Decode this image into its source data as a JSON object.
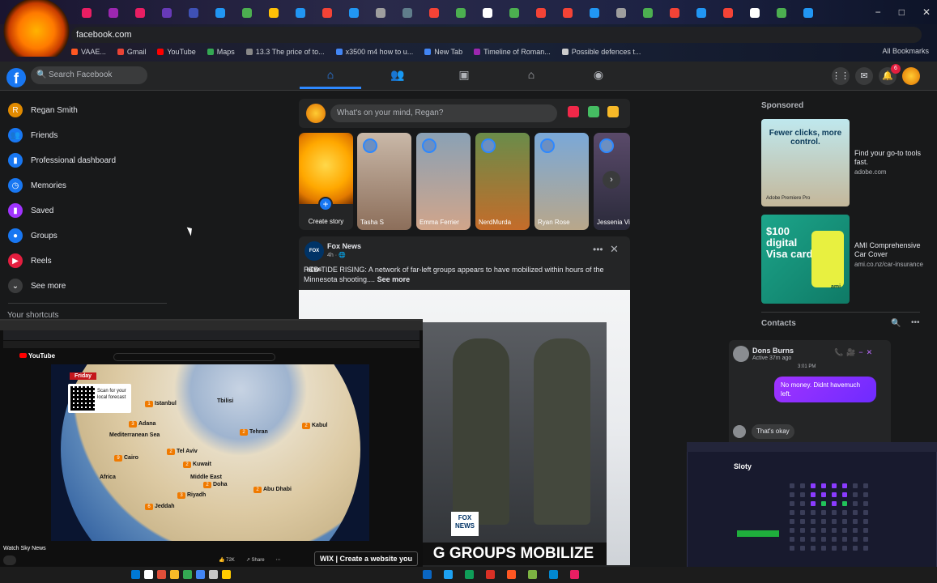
{
  "browser": {
    "url": "facebook.com",
    "bookmarks": [
      {
        "label": "VAAE...",
        "color": "#ff5722"
      },
      {
        "label": "Gmail",
        "color": "#ea4335"
      },
      {
        "label": "YouTube",
        "color": "#ff0000"
      },
      {
        "label": "Maps",
        "color": "#34a853"
      },
      {
        "label": "13.3 The price of to...",
        "color": "#888888"
      },
      {
        "label": "x3500 m4 how to u...",
        "color": "#4285f4"
      },
      {
        "label": "New Tab",
        "color": "#4285f4"
      },
      {
        "label": "Timeline of Roman...",
        "color": "#9c27b0"
      },
      {
        "label": "Possible defences t...",
        "color": "#cccccc"
      }
    ],
    "all_bookmarks": "All Bookmarks",
    "window_controls": [
      "−",
      "□",
      "✕"
    ]
  },
  "fb": {
    "logo_icon": "facebook-icon",
    "search_placeholder": "Search Facebook",
    "nav_tabs": [
      "home-icon",
      "friends-icon",
      "watch-icon",
      "marketplace-icon",
      "groups-icon"
    ],
    "right_icons": [
      "menu-grid-icon",
      "messenger-icon",
      "notifications-icon",
      "account-icon"
    ],
    "notification_count": "6"
  },
  "sidebar": {
    "items": [
      {
        "label": "Regan Smith",
        "color": "#e08a00",
        "icon": "R"
      },
      {
        "label": "Friends",
        "color": "#1877f2",
        "icon": "👥"
      },
      {
        "label": "Professional dashboard",
        "color": "#1877f2",
        "icon": "▮"
      },
      {
        "label": "Memories",
        "color": "#1877f2",
        "icon": "◷"
      },
      {
        "label": "Saved",
        "color": "#a033ff",
        "icon": "▮"
      },
      {
        "label": "Groups",
        "color": "#1877f2",
        "icon": "●"
      },
      {
        "label": "Reels",
        "color": "#e41e3f",
        "icon": "▶"
      },
      {
        "label": "See more",
        "color": "#3a3b3c",
        "icon": "⌄"
      }
    ],
    "shortcuts_label": "Your shortcuts"
  },
  "composer": {
    "placeholder": "What's on your mind, Regan?"
  },
  "stories": {
    "create_label": "Create story",
    "items": [
      {
        "name": "Tasha S",
        "bg": "linear-gradient(180deg,#c9b8a8,#8c6e5a)"
      },
      {
        "name": "Emma Ferrier",
        "bg": "linear-gradient(180deg,#8aa1b5,#d1a58a)"
      },
      {
        "name": "NerdMurda",
        "bg": "linear-gradient(180deg,#6a8c4a,#c46c2a)"
      },
      {
        "name": "Ryan Rose",
        "bg": "linear-gradient(180deg,#7aa8d8,#b9a78a)"
      },
      {
        "name": "Jessenia Vi",
        "bg": "linear-gradient(180deg,#5a4a6a,#2a2a3a)"
      }
    ]
  },
  "post": {
    "author": "Fox News",
    "meta": "4h · 🌐",
    "text": "RED TIDE RISING: A network of far-left groups appears to have mobilized within hours of the Minnesota shooting....",
    "see_more": "See more",
    "image_caption": "G GROUPS MOBILIZE",
    "image_logo": "FOX NEWS"
  },
  "right": {
    "sponsored": "Sponsored",
    "ads": [
      {
        "headline": "Find your go-to tools fast.",
        "domain": "adobe.com",
        "img_title": "Fewer clicks, more control.",
        "img_brand": "Adobe Premiere Pro"
      },
      {
        "headline": "AMI Comprehensive Car Cover",
        "domain": "ami.co.nz/car-insurance",
        "img_title": "$100 digital Visa card",
        "img_brand": "ami"
      }
    ],
    "contacts": "Contacts"
  },
  "chat": {
    "name": "Dons Burns",
    "status": "Active 37m ago",
    "time": "3:01 PM",
    "my_message": "No money. Didnt havemuch left.",
    "their_message": "That's okay"
  },
  "youtube_pip": {
    "day_banner": "Friday",
    "qr_text": "Scan for your local forecast",
    "map_labels": [
      {
        "text": "Istanbul",
        "pin": "1"
      },
      {
        "text": "Tbilisi",
        "pin": ""
      },
      {
        "text": "Adana",
        "pin": "3"
      },
      {
        "text": "Mediterranean Sea",
        "pin": ""
      },
      {
        "text": "Tehran",
        "pin": "2"
      },
      {
        "text": "Kabul",
        "pin": "2"
      },
      {
        "text": "Tel Aviv",
        "pin": "2"
      },
      {
        "text": "Cairo",
        "pin": "9"
      },
      {
        "text": "Kuwait",
        "pin": "2"
      },
      {
        "text": "Africa",
        "pin": ""
      },
      {
        "text": "Middle East",
        "pin": ""
      },
      {
        "text": "Doha",
        "pin": "2"
      },
      {
        "text": "Abu Dhabi",
        "pin": "2"
      },
      {
        "text": "Riyadh",
        "pin": "3"
      },
      {
        "text": "Jeddah",
        "pin": "6"
      }
    ],
    "video_title": "Watch Sky News",
    "actions": [
      "👍 72K",
      "↗ Share",
      "⋯"
    ],
    "ad_text": "WIX | Create a website you"
  },
  "planner": {
    "app_name": "Sloty"
  }
}
